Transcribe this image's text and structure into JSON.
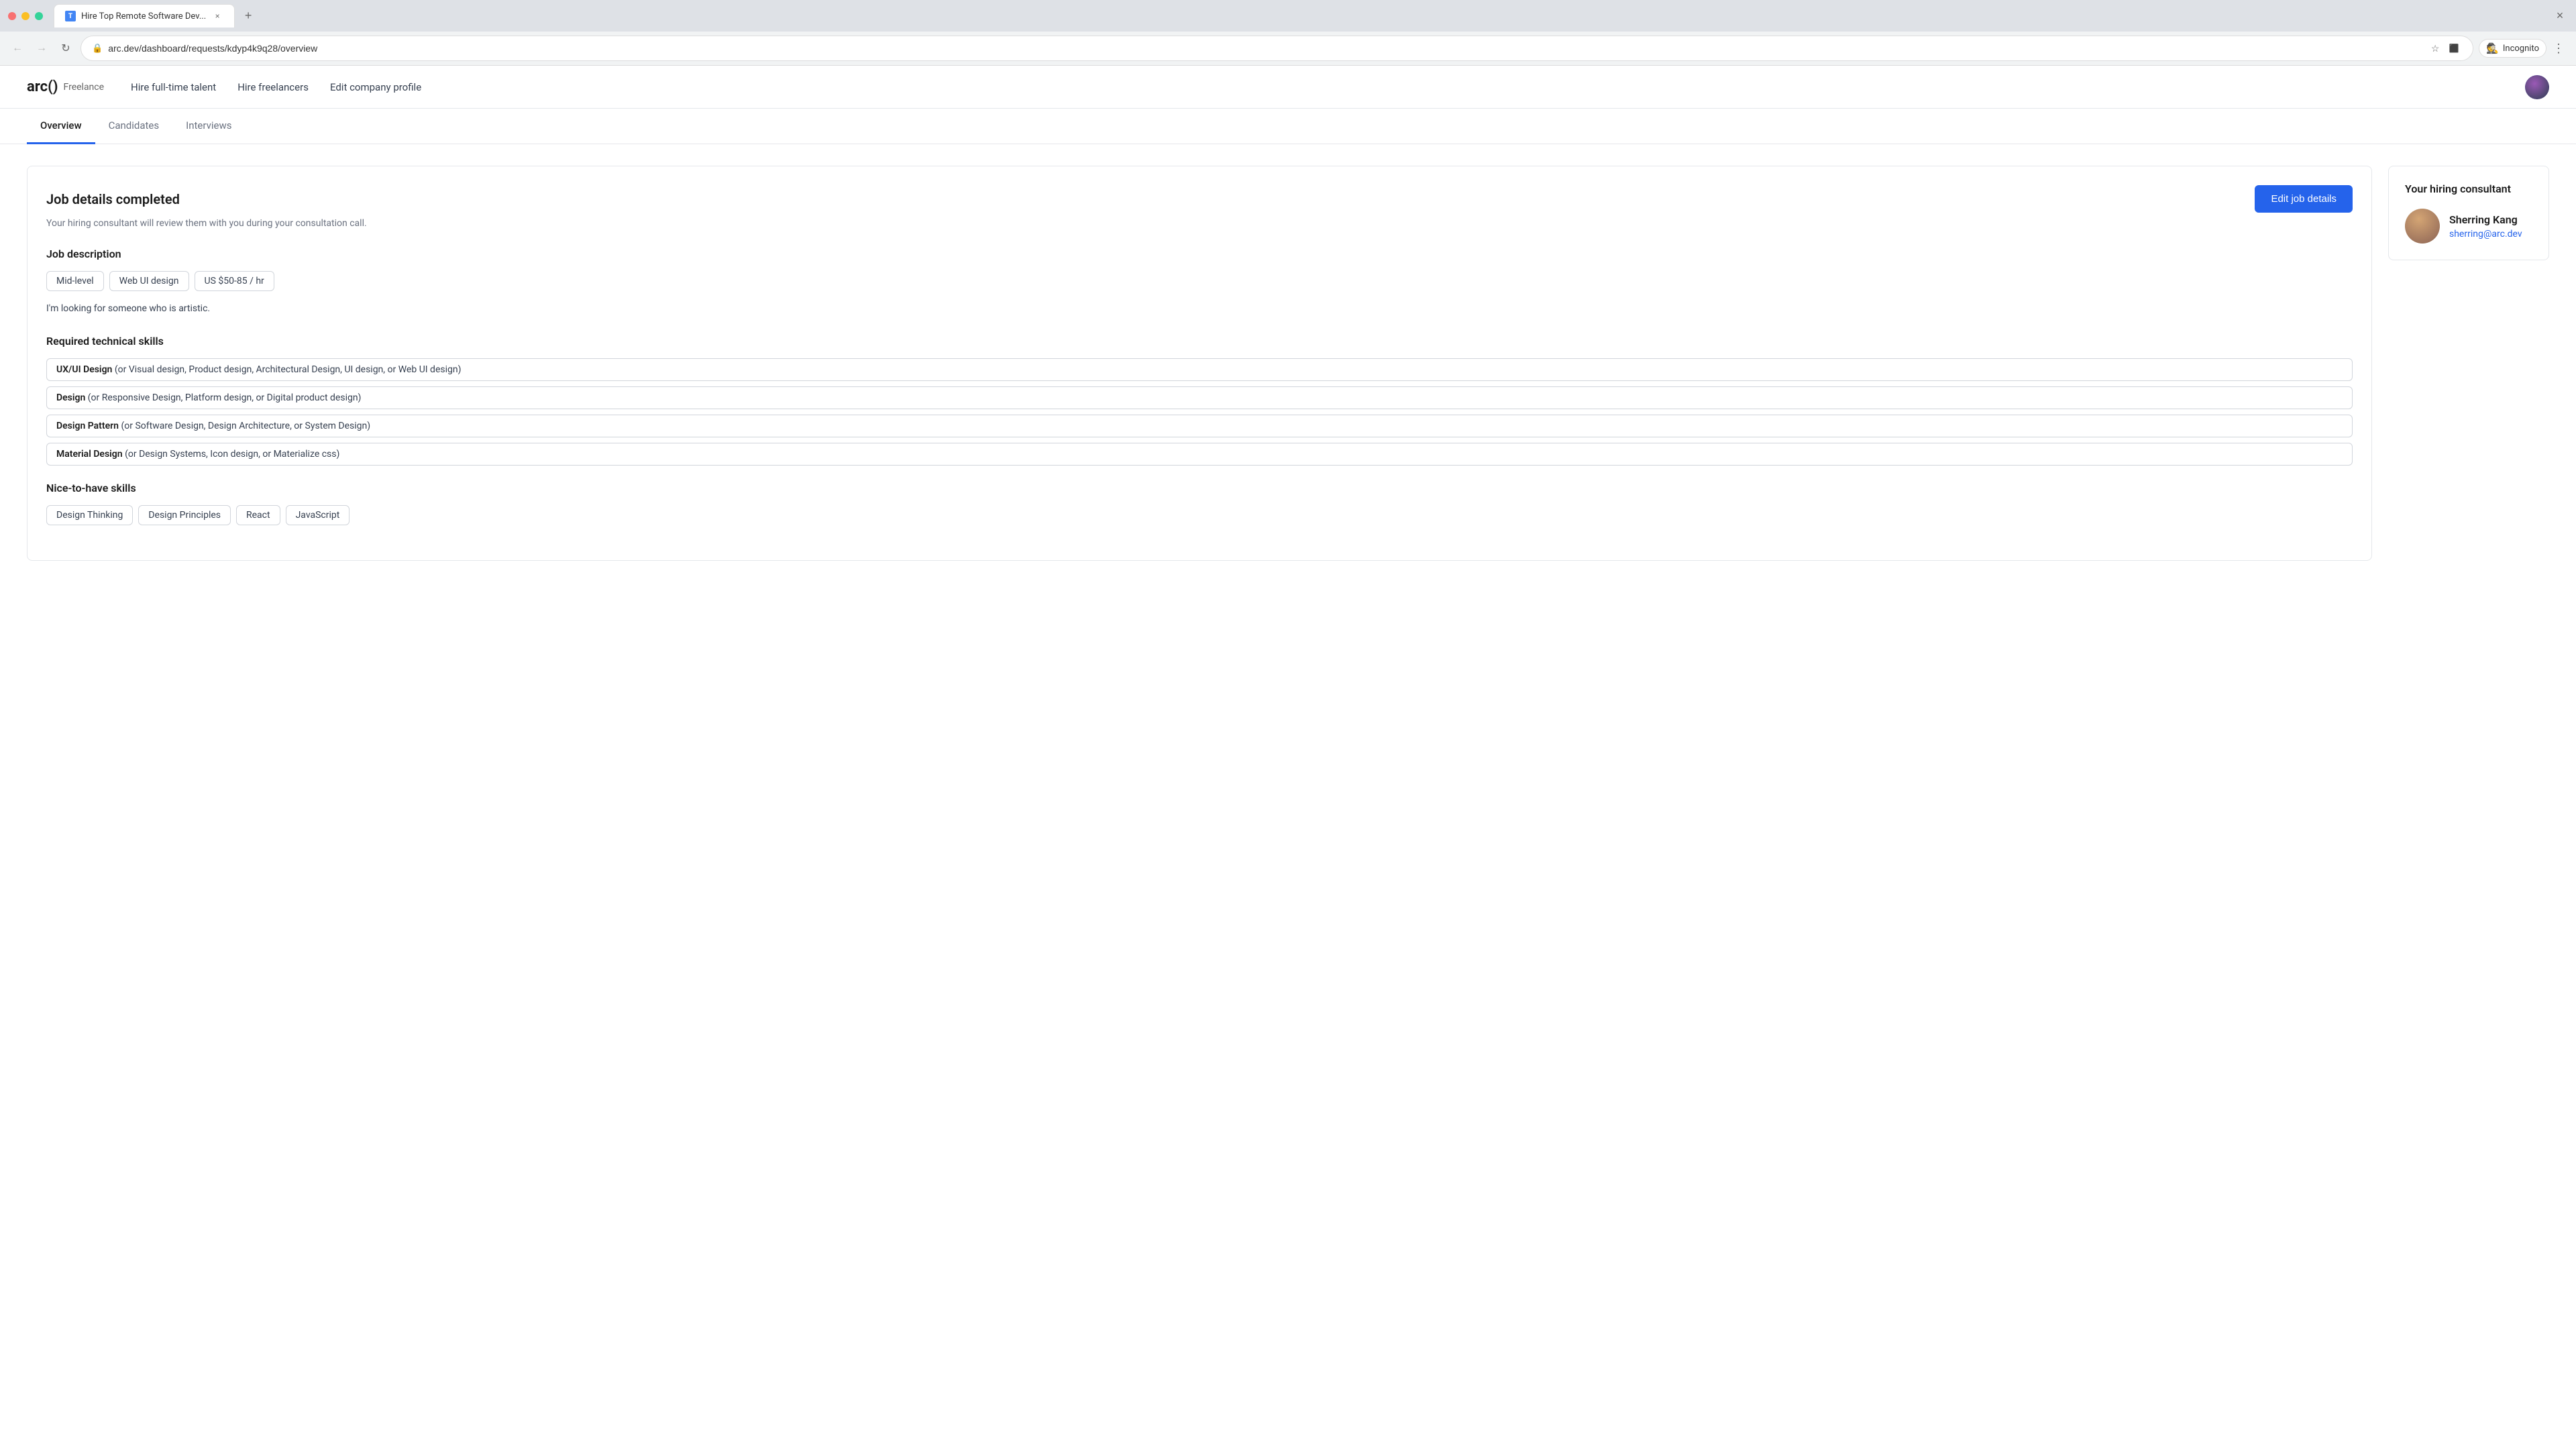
{
  "browser": {
    "tab_label": "Hire Top Remote Software Dev...",
    "url": "arc.dev/dashboard/requests/kdyp4k9q28/overview",
    "new_tab_label": "+",
    "incognito_label": "Incognito"
  },
  "header": {
    "logo_text": "arc()",
    "logo_suffix": "Freelance",
    "nav": {
      "hire_fulltime": "Hire full-time talent",
      "hire_freelancers": "Hire freelancers",
      "edit_profile": "Edit company profile"
    }
  },
  "tabs": {
    "overview": "Overview",
    "candidates": "Candidates",
    "interviews": "Interviews"
  },
  "job_card": {
    "title": "Job details completed",
    "subtitle": "Your hiring consultant will review them with you during your consultation call.",
    "edit_button": "Edit job details",
    "job_description_label": "Job description",
    "tags": [
      "Mid-level",
      "Web UI design",
      "US $50-85 / hr"
    ],
    "description": "I'm looking for someone who is artistic.",
    "required_skills_label": "Required technical skills",
    "required_skills": [
      {
        "main": "UX/UI Design",
        "alt": "(or Visual design, Product design, Architectural Design, UI design, or Web UI design)"
      },
      {
        "main": "Design",
        "alt": "(or Responsive Design, Platform design, or Digital product design)"
      },
      {
        "main": "Design Pattern",
        "alt": "(or Software Design, Design Architecture, or System Design)"
      },
      {
        "main": "Material Design",
        "alt": "(or Design Systems, Icon design, or Materialize css)"
      }
    ],
    "nice_to_have_label": "Nice-to-have skills",
    "nice_to_have_skills": [
      "Design Thinking",
      "Design Principles",
      "React",
      "JavaScript"
    ]
  },
  "consultant": {
    "title": "Your hiring consultant",
    "name": "Sherring Kang",
    "email": "sherring@arc.dev"
  },
  "icons": {
    "back": "←",
    "forward": "→",
    "refresh": "↻",
    "star": "☆",
    "extensions": "⬛",
    "more": "⋮",
    "close_tab": "×",
    "lock": "🔒"
  }
}
